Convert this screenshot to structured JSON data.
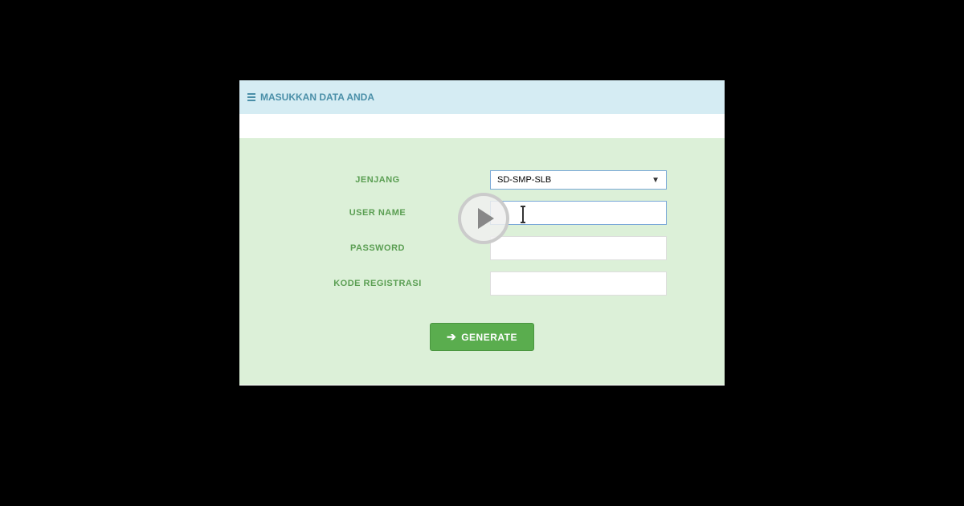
{
  "panel": {
    "title": "MASUKKAN DATA ANDA"
  },
  "form": {
    "jenjang": {
      "label": "JENJANG",
      "selected": "SD-SMP-SLB"
    },
    "username": {
      "label": "USER NAME",
      "value": ""
    },
    "password": {
      "label": "PASSWORD",
      "value": ""
    },
    "kode_registrasi": {
      "label": "KODE REGISTRASI",
      "value": ""
    }
  },
  "buttons": {
    "generate": "GENERATE"
  }
}
